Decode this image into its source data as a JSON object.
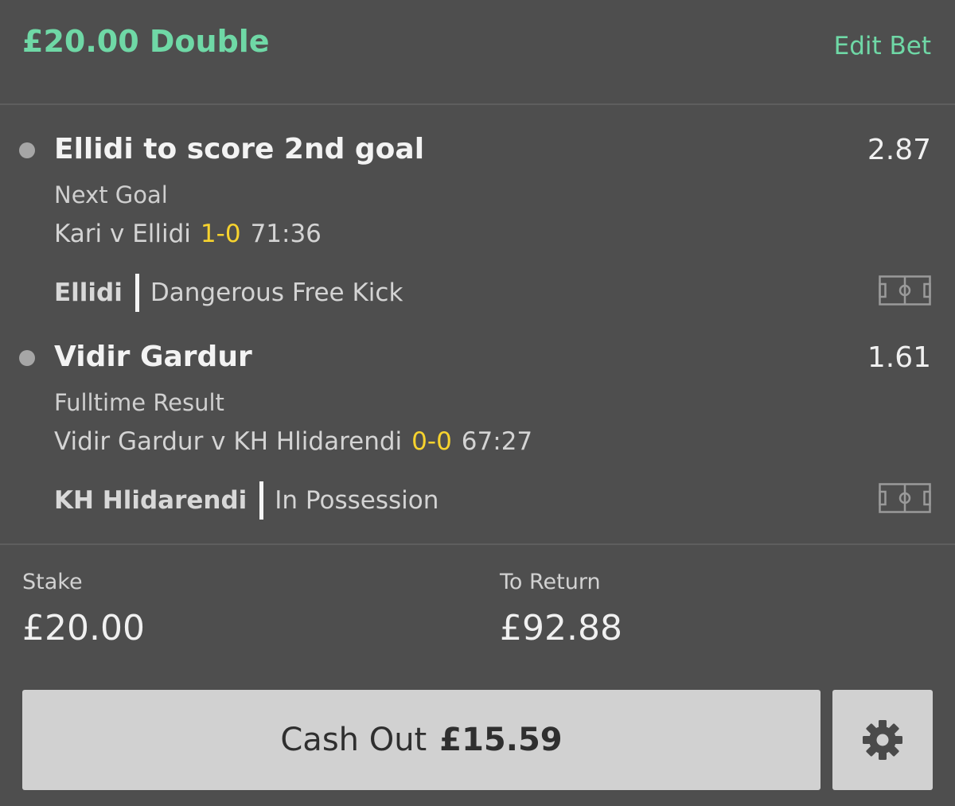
{
  "header": {
    "bet_title": "£20.00 Double",
    "edit_label": "Edit Bet",
    "accent_color": "#6fd8a6"
  },
  "selections": [
    {
      "name": "Ellidi to score 2nd goal",
      "odds": "2.87",
      "market": "Next Goal",
      "match": "Kari v Ellidi",
      "score": "1-0",
      "clock": "71:36",
      "event_team": "Ellidi",
      "event_text": "Dangerous Free Kick",
      "icon": "pitch-icon"
    },
    {
      "name": "Vidir Gardur",
      "odds": "1.61",
      "market": "Fulltime Result",
      "match": "Vidir Gardur v KH Hlidarendi",
      "score": "0-0",
      "clock": "67:27",
      "event_team": "KH Hlidarendi",
      "event_text": "In Possession",
      "icon": "pitch-icon"
    }
  ],
  "summary": {
    "stake_label": "Stake",
    "stake_value": "£20.00",
    "return_label": "To Return",
    "return_value": "£92.88"
  },
  "cashout": {
    "label": "Cash Out",
    "amount": "£15.59",
    "settings_icon": "gear-icon"
  },
  "colors": {
    "background": "#4e4e4e",
    "score": "#f7d32e",
    "button": "#d1d1d1"
  }
}
